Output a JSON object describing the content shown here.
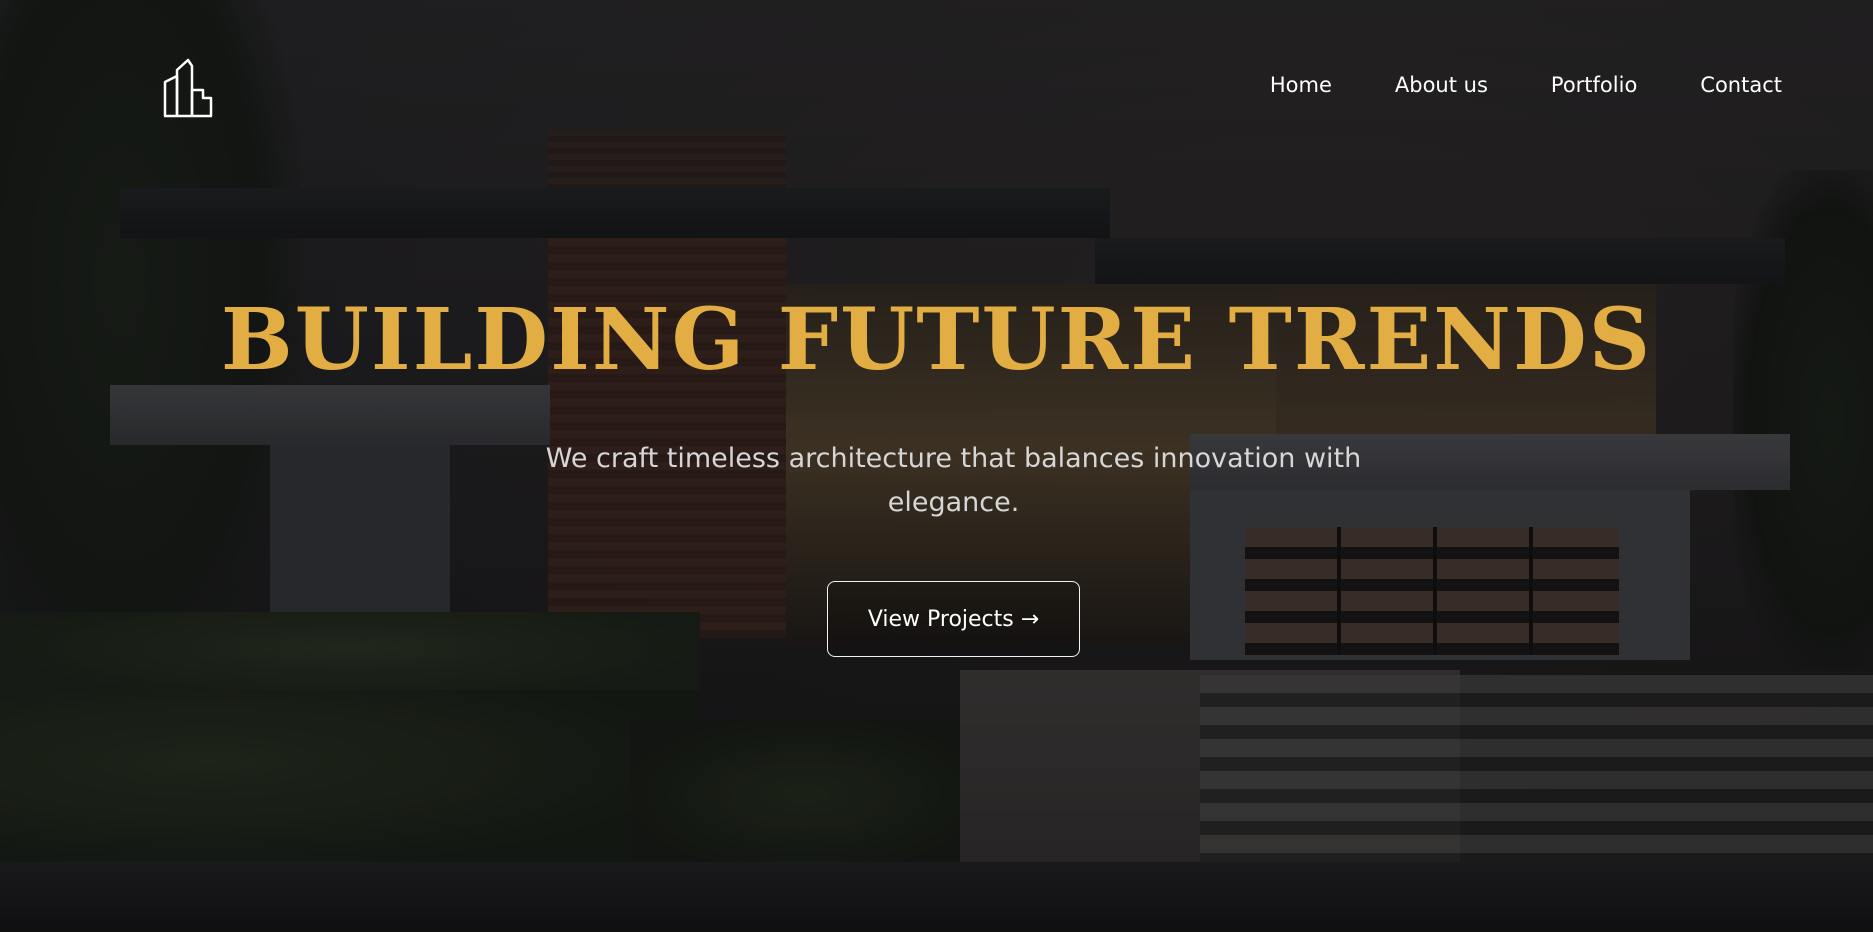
{
  "logo": {
    "icon": "building-icon"
  },
  "nav": {
    "items": [
      {
        "label": "Home"
      },
      {
        "label": "About us"
      },
      {
        "label": "Portfolio"
      },
      {
        "label": "Contact"
      }
    ]
  },
  "hero": {
    "title": "BUILDING FUTURE TRENDS",
    "subtitle": "We craft timeless architecture that balances innovation with elegance.",
    "cta_label": "View Projects →"
  },
  "colors": {
    "accent": "#e2ad43",
    "text": "#ffffff",
    "subtext": "#d6d6d6"
  }
}
